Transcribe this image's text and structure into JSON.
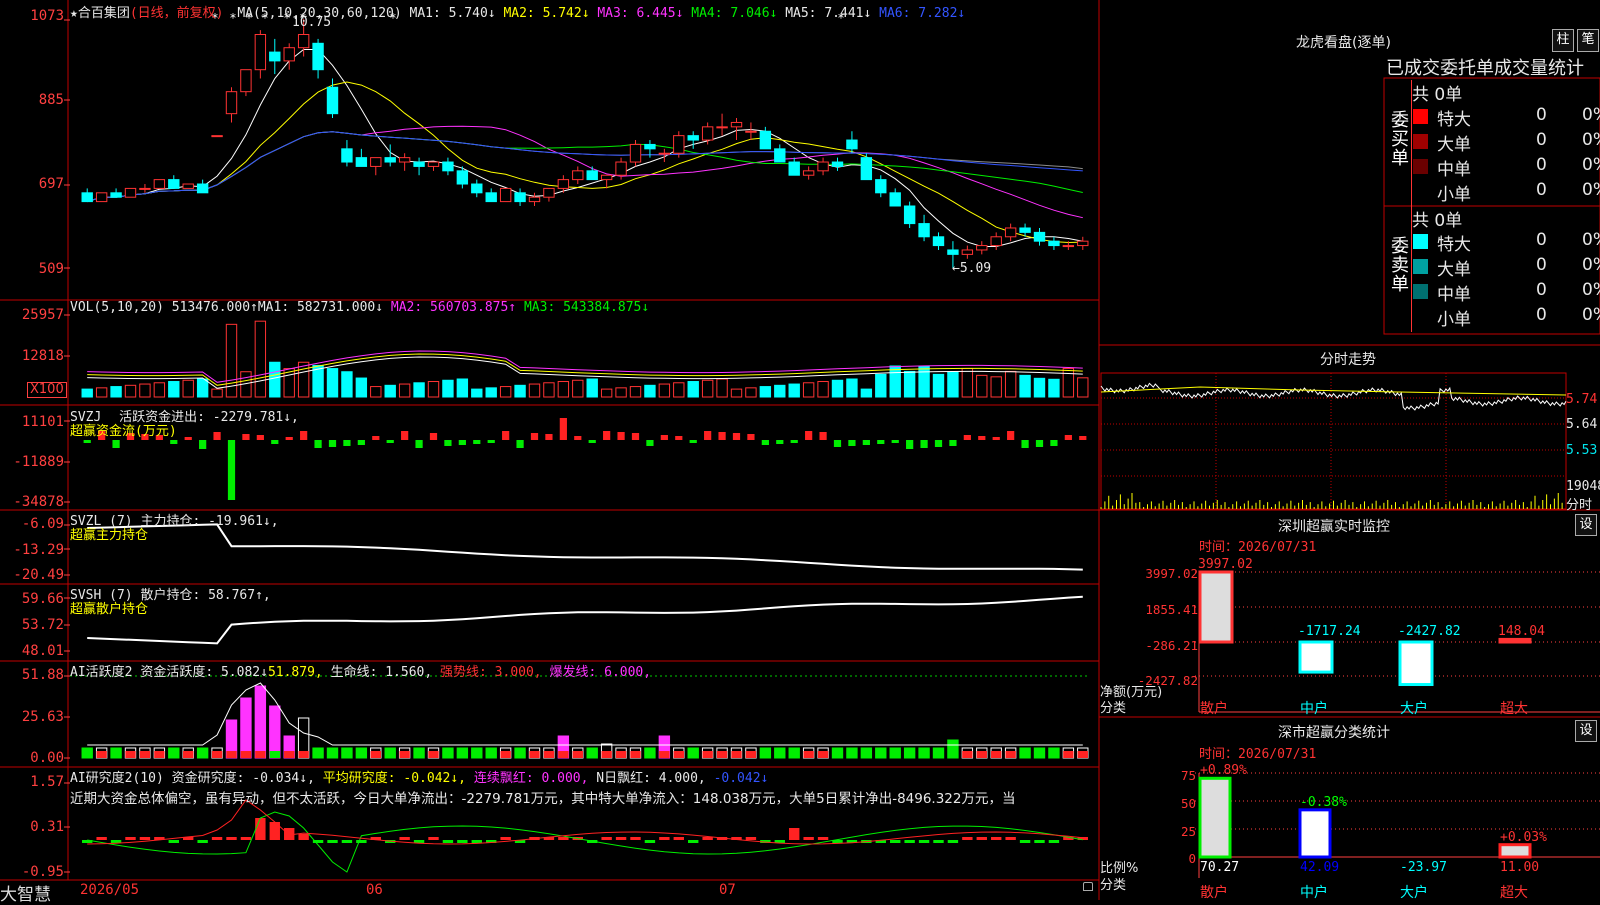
{
  "main_chart": {
    "title": "★合百集团",
    "mode": "(日线，前复权)",
    "ma_label": "MA(5,10,20,30,60,120)",
    "ma1": "MA1: 5.740↓",
    "ma2": "MA2: 5.742↓",
    "ma3": "MA3: 6.445↓",
    "ma4": "MA4: 7.046↓",
    "ma5": "MA5: 7.441↓",
    "ma6": "MA6: 7.282↓",
    "y_labels": [
      "1073",
      "885",
      "697",
      "509"
    ],
    "high_note": "10.75",
    "low_note": "←5.09"
  },
  "vol_panel": {
    "header": "VOL(5,10,20)",
    "value": "513476.000↑",
    "ma1": "MA1: 582731.000↓",
    "ma2": "MA2: 560703.875↑",
    "ma3": "MA3: 543384.875↓",
    "y_labels": [
      "25957",
      "12818"
    ],
    "unit": "X100"
  },
  "svzj_panel": {
    "header": "SVZJ",
    "label": "活跃资金进出: -2279.781↓,",
    "sub": "超赢资金流(万元)",
    "y_labels": [
      "11101",
      "-11889",
      "-34878"
    ]
  },
  "svzl_panel": {
    "header": "SVZL (7)",
    "label": "主力持仓: -19.961↓,",
    "sub": "超赢主力持仓",
    "y_labels": [
      "-6.09",
      "-13.29",
      "-20.49"
    ]
  },
  "svsh_panel": {
    "header": "SVSH (7)",
    "label": "散户持仓: 58.767↑,",
    "sub": "超赢散户持仓",
    "y_labels": [
      "59.66",
      "53.72",
      "48.01"
    ]
  },
  "ai_active_panel": {
    "header": "AI活跃度2",
    "label": "资金活跃度: 5.082↓",
    "v2": "51.879,",
    "v3": "生命线: 1.560,",
    "v4": "强势线: 3.000,",
    "v5": "爆发线: 6.000,",
    "y_labels": [
      "51.88",
      "25.63",
      "0.00"
    ]
  },
  "ai_research_panel": {
    "header": "AI研究度2(10)",
    "label": "资金研究度: -0.034↓,",
    "v2": "平均研究度: -0.042↓,",
    "v3": "连续飘红: 0.000,",
    "v4": "N日飘红: 4.000,",
    "v5": "-0.042↓",
    "comment": "近期大资金总体偏空，虽有异动，但不太活跃，今日大单净流出：-2279.781万元，其中特大单净流入：148.038万元，大单5日累计净出-8496.322万元，当",
    "y_labels": [
      "1.57",
      "0.31",
      "-0.95"
    ]
  },
  "bottom_bar": {
    "brand": "大智慧",
    "dates": [
      "2026/05",
      "06",
      "07"
    ]
  },
  "order_panel": {
    "title": "龙虎看盘(逐单)",
    "btn1": "柱",
    "btn2": "笔",
    "subtitle": "已成交委托单成交量统计",
    "buy_label": "委买单",
    "sell_label": "委卖单",
    "buy_total": "共 0单",
    "sell_total": "共 0单",
    "buy_rows": [
      {
        "name": "特大",
        "count": "0",
        "pct": "0%",
        "color": "#ff0000"
      },
      {
        "name": "大单",
        "count": "0",
        "pct": "0%",
        "color": "#a00000"
      },
      {
        "name": "中单",
        "count": "0",
        "pct": "0%",
        "color": "#6a0000"
      },
      {
        "name": "小单",
        "count": "0",
        "pct": "0%",
        "color": "#000000"
      }
    ],
    "sell_rows": [
      {
        "name": "特大",
        "count": "0",
        "pct": "0%",
        "color": "#00ffff"
      },
      {
        "name": "大单",
        "count": "0",
        "pct": "0%",
        "color": "#00a0a0"
      },
      {
        "name": "中单",
        "count": "0",
        "pct": "0%",
        "color": "#007070"
      },
      {
        "name": "小单",
        "count": "0",
        "pct": "0%",
        "color": "#000000"
      }
    ]
  },
  "intraday_panel": {
    "title": "分时走势",
    "prices": [
      "5.74",
      "5.64",
      "5.53"
    ],
    "vol": "19048",
    "vol_label": "分时"
  },
  "sz_monitor": {
    "title": "深圳超赢实时监控",
    "settings": "设",
    "time": "时间：2026/07/31",
    "y_labels": [
      "3997.02",
      "1855.41",
      "-286.21",
      "-2427.82"
    ],
    "axis_title": "净额(万元)",
    "axis_sub": "分类",
    "bars": [
      {
        "cat": "散户",
        "value": 3997.02,
        "label": "3997.02"
      },
      {
        "cat": "中户",
        "value": -1717.24,
        "label": "-1717.24"
      },
      {
        "cat": "大户",
        "value": -2427.82,
        "label": "-2427.82"
      },
      {
        "cat": "超大",
        "value": 148.04,
        "label": "148.04"
      }
    ]
  },
  "sz_category": {
    "title": "深市超赢分类统计",
    "settings": "设",
    "time": "时间：2026/07/31",
    "y_labels": [
      "75",
      "50",
      "25",
      "0"
    ],
    "axis_title": "比例%",
    "axis_sub": "分类",
    "bars": [
      {
        "cat": "散户",
        "pct": 70.27,
        "change": "+0.89%",
        "value": "70.27"
      },
      {
        "cat": "中户",
        "pct": 42.09,
        "change": "-0.38%",
        "value": "42.09"
      },
      {
        "cat": "大户",
        "pct": 0,
        "change": "",
        "value": "-23.97"
      },
      {
        "cat": "超大",
        "pct": 11.0,
        "change": "+0.03%",
        "value": "11.00"
      }
    ]
  },
  "chart_data": {
    "type": "candlestick",
    "candles": [
      [
        6.8,
        6.9,
        6.6,
        6.6
      ],
      [
        6.6,
        6.8,
        6.6,
        6.8
      ],
      [
        6.8,
        6.9,
        6.7,
        6.7
      ],
      [
        6.7,
        6.9,
        6.7,
        6.9
      ],
      [
        6.9,
        7.0,
        6.8,
        6.9
      ],
      [
        6.9,
        7.1,
        6.9,
        7.1
      ],
      [
        7.1,
        7.2,
        6.9,
        6.9
      ],
      [
        6.9,
        7.0,
        6.9,
        7.0
      ],
      [
        7.0,
        7.1,
        6.8,
        6.8
      ],
      [
        8.1,
        8.1,
        8.1,
        8.1
      ],
      [
        8.6,
        9.2,
        8.4,
        9.1
      ],
      [
        9.1,
        9.6,
        9.0,
        9.6
      ],
      [
        9.6,
        10.5,
        9.4,
        10.4
      ],
      [
        10.0,
        10.3,
        9.5,
        9.8
      ],
      [
        9.8,
        10.2,
        9.6,
        10.1
      ],
      [
        10.1,
        10.75,
        9.9,
        10.4
      ],
      [
        10.2,
        10.3,
        9.4,
        9.6
      ],
      [
        9.2,
        9.4,
        8.5,
        8.6
      ],
      [
        7.8,
        8.0,
        7.4,
        7.5
      ],
      [
        7.6,
        7.8,
        7.4,
        7.4
      ],
      [
        7.4,
        7.6,
        7.2,
        7.6
      ],
      [
        7.6,
        7.9,
        7.4,
        7.5
      ],
      [
        7.5,
        7.7,
        7.3,
        7.6
      ],
      [
        7.5,
        7.6,
        7.2,
        7.4
      ],
      [
        7.4,
        7.5,
        7.3,
        7.5
      ],
      [
        7.5,
        7.6,
        7.2,
        7.3
      ],
      [
        7.3,
        7.4,
        6.9,
        7.0
      ],
      [
        7.0,
        7.1,
        6.7,
        6.8
      ],
      [
        6.8,
        6.9,
        6.6,
        6.6
      ],
      [
        6.6,
        6.9,
        6.6,
        6.9
      ],
      [
        6.8,
        6.9,
        6.5,
        6.6
      ],
      [
        6.6,
        6.8,
        6.5,
        6.7
      ],
      [
        6.7,
        6.9,
        6.6,
        6.9
      ],
      [
        6.9,
        7.2,
        6.8,
        7.1
      ],
      [
        7.1,
        7.4,
        7.0,
        7.3
      ],
      [
        7.3,
        7.4,
        7.1,
        7.1
      ],
      [
        7.1,
        7.2,
        6.9,
        7.2
      ],
      [
        7.2,
        7.6,
        7.1,
        7.5
      ],
      [
        7.5,
        8.0,
        7.4,
        7.9
      ],
      [
        7.9,
        8.0,
        7.6,
        7.8
      ],
      [
        7.7,
        7.8,
        7.5,
        7.7
      ],
      [
        7.7,
        8.2,
        7.6,
        8.1
      ],
      [
        8.1,
        8.2,
        7.8,
        8.0
      ],
      [
        8.0,
        8.4,
        7.9,
        8.3
      ],
      [
        8.3,
        8.6,
        8.1,
        8.3
      ],
      [
        8.3,
        8.5,
        8.0,
        8.4
      ],
      [
        8.2,
        8.4,
        8.0,
        8.2
      ],
      [
        8.2,
        8.3,
        7.8,
        7.8
      ],
      [
        7.8,
        7.9,
        7.5,
        7.5
      ],
      [
        7.5,
        7.6,
        7.2,
        7.2
      ],
      [
        7.2,
        7.4,
        7.1,
        7.3
      ],
      [
        7.3,
        7.6,
        7.2,
        7.5
      ],
      [
        7.5,
        7.6,
        7.3,
        7.4
      ],
      [
        8.0,
        8.2,
        7.7,
        7.8
      ],
      [
        7.6,
        7.7,
        7.1,
        7.1
      ],
      [
        7.1,
        7.2,
        6.7,
        6.8
      ],
      [
        6.8,
        6.9,
        6.5,
        6.5
      ],
      [
        6.5,
        6.6,
        6.0,
        6.1
      ],
      [
        6.1,
        6.3,
        5.7,
        5.8
      ],
      [
        5.8,
        5.9,
        5.5,
        5.6
      ],
      [
        5.5,
        5.7,
        5.09,
        5.4
      ],
      [
        5.4,
        5.6,
        5.3,
        5.5
      ],
      [
        5.5,
        5.7,
        5.4,
        5.6
      ],
      [
        5.6,
        5.9,
        5.5,
        5.8
      ],
      [
        5.8,
        6.1,
        5.7,
        6.0
      ],
      [
        6.0,
        6.1,
        5.8,
        5.9
      ],
      [
        5.9,
        6.0,
        5.6,
        5.7
      ],
      [
        5.7,
        5.8,
        5.5,
        5.6
      ],
      [
        5.6,
        5.7,
        5.5,
        5.6
      ],
      [
        5.6,
        5.8,
        5.5,
        5.7
      ]
    ],
    "volume_tail": [
      0.46,
      0.63,
      0.52,
      0.62,
      0.46,
      0.5,
      0.58,
      0.44,
      0.41,
      0.52,
      0.44,
      0.38,
      0.36,
      0.58,
      0.39
    ],
    "y_range": [
      5.09,
      10.75
    ]
  }
}
